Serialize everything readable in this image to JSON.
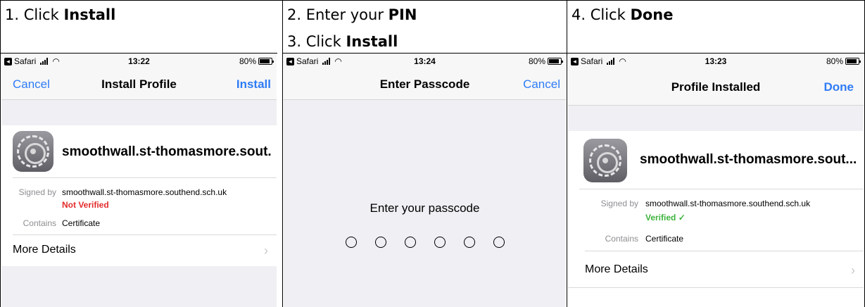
{
  "steps": {
    "col1": {
      "prefix": "1. Click ",
      "bold": "Install"
    },
    "col2a": {
      "prefix": "2. Enter your ",
      "bold": "PIN"
    },
    "col2b": {
      "prefix": "3. Click ",
      "bold": "Install"
    },
    "col3": {
      "prefix": "4. Click ",
      "bold": "Done"
    }
  },
  "screens": [
    {
      "status": {
        "carrier": "Safari",
        "time": "13:22",
        "battery": "80%",
        "battery_level": 0.8
      },
      "nav": {
        "left": "Cancel",
        "title": "Install Profile",
        "right": "Install"
      },
      "profile_name": "smoothwall.st-thomasmore.sout...",
      "signed_by_label": "Signed by",
      "signed_by": "smoothwall.st-thomasmore.southend.sch.uk",
      "verification": "Not Verified",
      "contains_label": "Contains",
      "contains": "Certificate",
      "more_details": "More Details"
    },
    {
      "status": {
        "carrier": "Safari",
        "time": "13:24",
        "battery": "80%",
        "battery_level": 0.8
      },
      "nav": {
        "title": "Enter Passcode",
        "right": "Cancel"
      },
      "passcode_prompt": "Enter your passcode",
      "passcode_length": 6
    },
    {
      "status": {
        "carrier": "Safari",
        "time": "13:23",
        "battery": "80%",
        "battery_level": 0.8
      },
      "nav": {
        "title": "Profile Installed",
        "right": "Done"
      },
      "profile_name": "smoothwall.st-thomasmore.sout...",
      "signed_by_label": "Signed by",
      "signed_by": "smoothwall.st-thomasmore.southend.sch.uk",
      "verification": "Verified ✓",
      "contains_label": "Contains",
      "contains": "Certificate",
      "more_details": "More Details"
    }
  ],
  "icons": {
    "app_icon": "settings-gear-icon",
    "chevron": "chevron-right-icon"
  },
  "colors": {
    "link": "#2f7cf6",
    "not_verified": "#e32b2b",
    "verified": "#3cb33c"
  }
}
